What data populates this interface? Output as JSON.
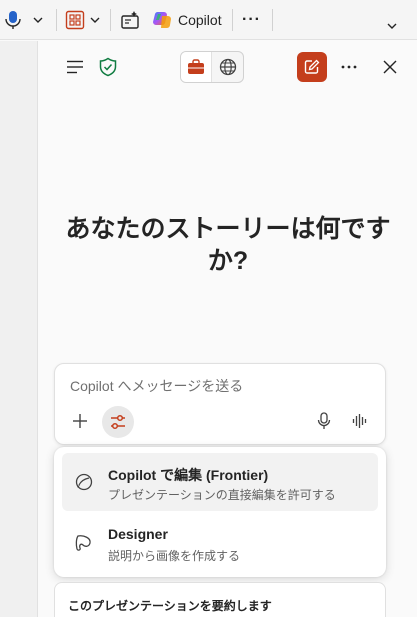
{
  "ribbon": {
    "copilot_label": "Copilot",
    "more_label": "···"
  },
  "panel": {
    "heading": "あなたのストーリーは何ですか?",
    "composer": {
      "placeholder": "Copilot へメッセージを送る"
    },
    "menu": {
      "items": [
        {
          "title": "Copilot で編集 (Frontier)",
          "description": "プレゼンテーションの直接編集を許可する",
          "icon": "copilot-edit-icon",
          "highlighted": true
        },
        {
          "title": "Designer",
          "description": "説明から画像を作成する",
          "icon": "designer-icon",
          "highlighted": false
        }
      ]
    },
    "suggestion": "このプレゼンテーションを要約します"
  },
  "colors": {
    "accent": "#c43e1c",
    "shield": "#107c41",
    "mic_blue": "#2563c9"
  }
}
